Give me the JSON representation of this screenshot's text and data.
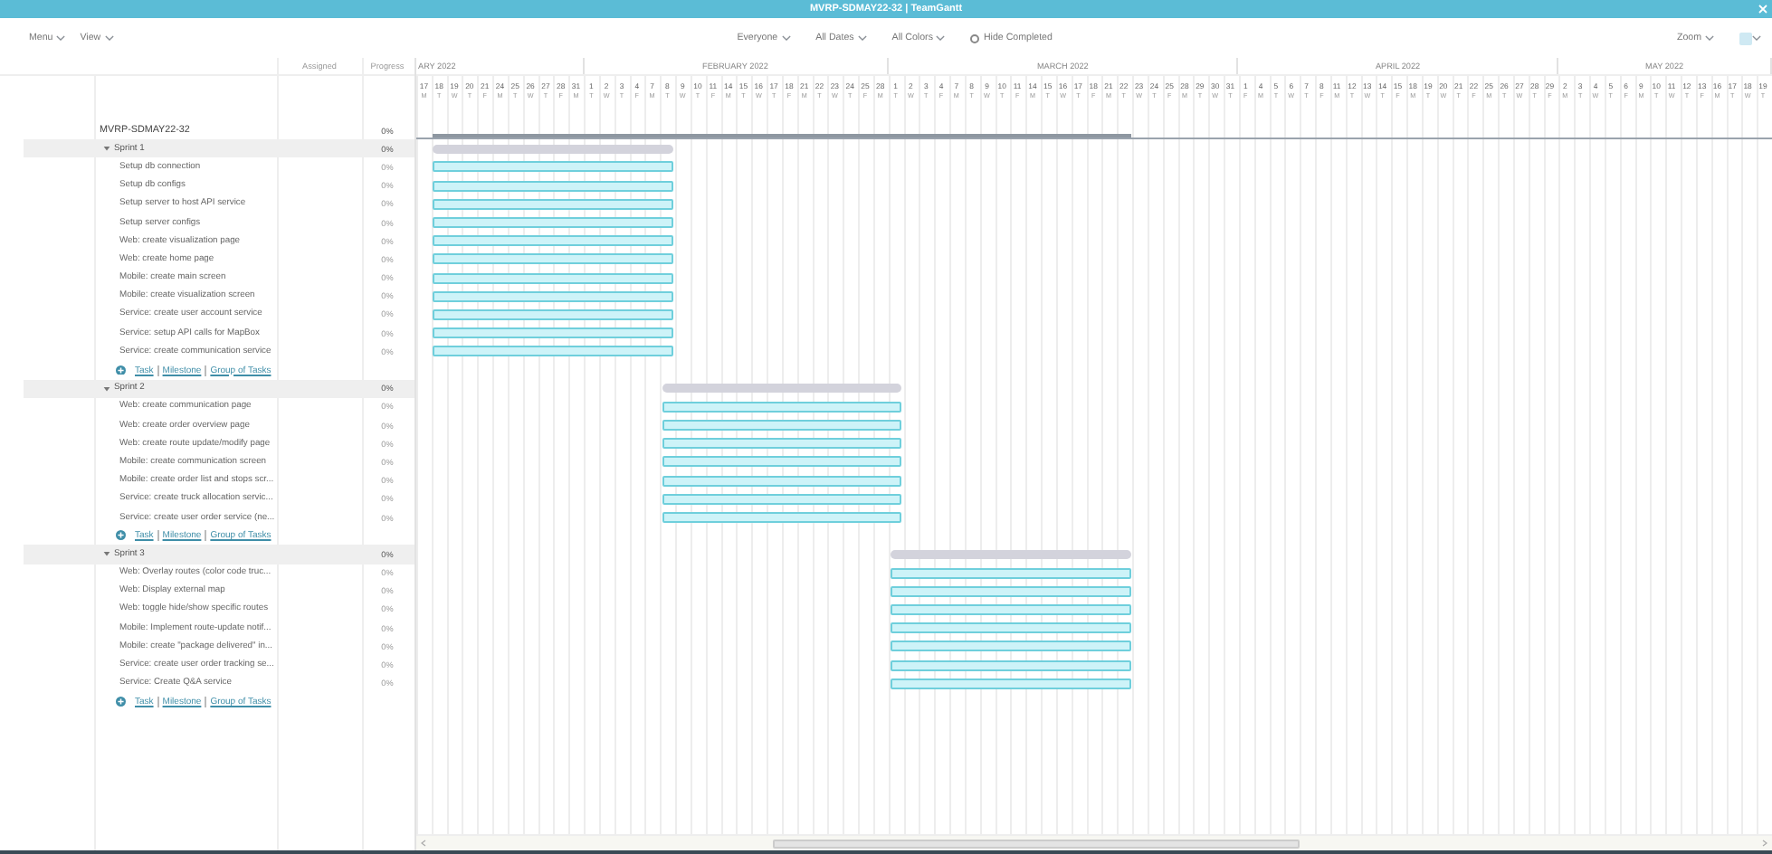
{
  "window": {
    "title": "MVRP-SDMAY22-32 | TeamGantt"
  },
  "toolbar": {
    "left": [
      {
        "label": "Menu"
      },
      {
        "label": "View"
      }
    ],
    "filters": [
      {
        "label": "Everyone"
      },
      {
        "label": "All Dates"
      },
      {
        "label": "All Colors"
      }
    ],
    "hide_completed": {
      "label": "Hide Completed",
      "checked": false
    },
    "zoom": {
      "label": "Zoom"
    }
  },
  "columns": {
    "assigned": "Assigned",
    "progress": "Progress"
  },
  "timeline": {
    "months": [
      {
        "label": "ARY 2022",
        "cut": true,
        "days": [
          "17",
          "18",
          "19",
          "20",
          "21",
          "24",
          "25",
          "26",
          "27",
          "28",
          "31"
        ],
        "weekdays": [
          "M",
          "T",
          "W",
          "T",
          "F",
          "M",
          "T",
          "W",
          "T",
          "F",
          "M"
        ]
      },
      {
        "label": "FEBRUARY 2022",
        "cut": false,
        "days": [
          "1",
          "2",
          "3",
          "4",
          "7",
          "8",
          "9",
          "10",
          "11",
          "14",
          "15",
          "16",
          "17",
          "18",
          "21",
          "22",
          "23",
          "24",
          "25",
          "28"
        ],
        "weekdays": [
          "T",
          "W",
          "T",
          "F",
          "M",
          "T",
          "W",
          "T",
          "F",
          "M",
          "T",
          "W",
          "T",
          "F",
          "M",
          "T",
          "W",
          "T",
          "F",
          "M"
        ]
      },
      {
        "label": "MARCH 2022",
        "cut": false,
        "days": [
          "1",
          "2",
          "3",
          "4",
          "7",
          "8",
          "9",
          "10",
          "11",
          "14",
          "15",
          "16",
          "17",
          "18",
          "21",
          "22",
          "23",
          "24",
          "25",
          "28",
          "29",
          "30",
          "31"
        ],
        "weekdays": [
          "T",
          "W",
          "T",
          "F",
          "M",
          "T",
          "W",
          "T",
          "F",
          "M",
          "T",
          "W",
          "T",
          "F",
          "M",
          "T",
          "W",
          "T",
          "F",
          "M",
          "T",
          "W",
          "T"
        ]
      },
      {
        "label": "APRIL 2022",
        "cut": false,
        "days": [
          "1",
          "4",
          "5",
          "6",
          "7",
          "8",
          "11",
          "12",
          "13",
          "14",
          "15",
          "18",
          "19",
          "20",
          "21",
          "22",
          "25",
          "26",
          "27",
          "28",
          "29"
        ],
        "weekdays": [
          "F",
          "M",
          "T",
          "W",
          "T",
          "F",
          "M",
          "T",
          "W",
          "T",
          "F",
          "M",
          "T",
          "W",
          "T",
          "F",
          "M",
          "T",
          "W",
          "T",
          "F"
        ]
      },
      {
        "label": "MAY 2022",
        "cut": false,
        "days": [
          "2",
          "3",
          "4",
          "5",
          "6",
          "9",
          "10",
          "11",
          "12",
          "13",
          "16",
          "17",
          "18",
          "19"
        ],
        "weekdays": [
          "M",
          "T",
          "W",
          "T",
          "F",
          "M",
          "T",
          "W",
          "T",
          "F",
          "M",
          "T",
          "W",
          "T"
        ]
      }
    ]
  },
  "project": {
    "name": "MVRP-SDMAY22-32",
    "progress": "0%",
    "groups": [
      {
        "name": "Sprint 1",
        "expanded": true,
        "progress": "0%",
        "tasks": [
          {
            "name": "Setup db connection",
            "progress": "0%"
          },
          {
            "name": "Setup db configs",
            "progress": "0%"
          },
          {
            "name": "Setup server to host API service",
            "progress": "0%"
          },
          {
            "name": "Setup server configs",
            "progress": "0%"
          },
          {
            "name": "Web: create visualization page",
            "progress": "0%"
          },
          {
            "name": "Web: create home page",
            "progress": "0%"
          },
          {
            "name": "Mobile: create main screen",
            "progress": "0%"
          },
          {
            "name": "Mobile: create visualization screen",
            "progress": "0%"
          },
          {
            "name": "Service: create user account service",
            "progress": "0%"
          },
          {
            "name": "Service: setup API calls for MapBox",
            "progress": "0%"
          },
          {
            "name": "Service: create communication service",
            "progress": "0%"
          }
        ],
        "add_links": [
          "Task",
          "Milestone",
          "Group of Tasks"
        ]
      },
      {
        "name": "Sprint 2",
        "expanded": true,
        "progress": "0%",
        "tasks": [
          {
            "name": "Web: create communication page",
            "progress": "0%"
          },
          {
            "name": "Web: create order overview page",
            "progress": "0%"
          },
          {
            "name": "Web: create route update/modify page",
            "progress": "0%"
          },
          {
            "name": "Mobile: create communication screen",
            "progress": "0%"
          },
          {
            "name": "Mobile: create order list and stops scr...",
            "progress": "0%"
          },
          {
            "name": "Service: create truck allocation servic...",
            "progress": "0%"
          },
          {
            "name": "Service: create user order service (ne...",
            "progress": "0%"
          }
        ],
        "add_links": [
          "Task",
          "Milestone",
          "Group of Tasks"
        ]
      },
      {
        "name": "Sprint 3",
        "expanded": true,
        "progress": "0%",
        "tasks": [
          {
            "name": "Web: Overlay routes (color code truc...",
            "progress": "0%"
          },
          {
            "name": "Web: Display external map",
            "progress": "0%"
          },
          {
            "name": "Web: toggle hide/show specific routes",
            "progress": "0%"
          },
          {
            "name": "Mobile: Implement route-update notif...",
            "progress": "0%"
          },
          {
            "name": "Mobile: create \"package delivered\" in...",
            "progress": "0%"
          },
          {
            "name": "Service: create user order tracking se...",
            "progress": "0%"
          },
          {
            "name": "Service: Create Q&A service",
            "progress": "0%"
          }
        ],
        "add_links": [
          "Task",
          "Milestone",
          "Group of Tasks"
        ]
      }
    ]
  }
}
